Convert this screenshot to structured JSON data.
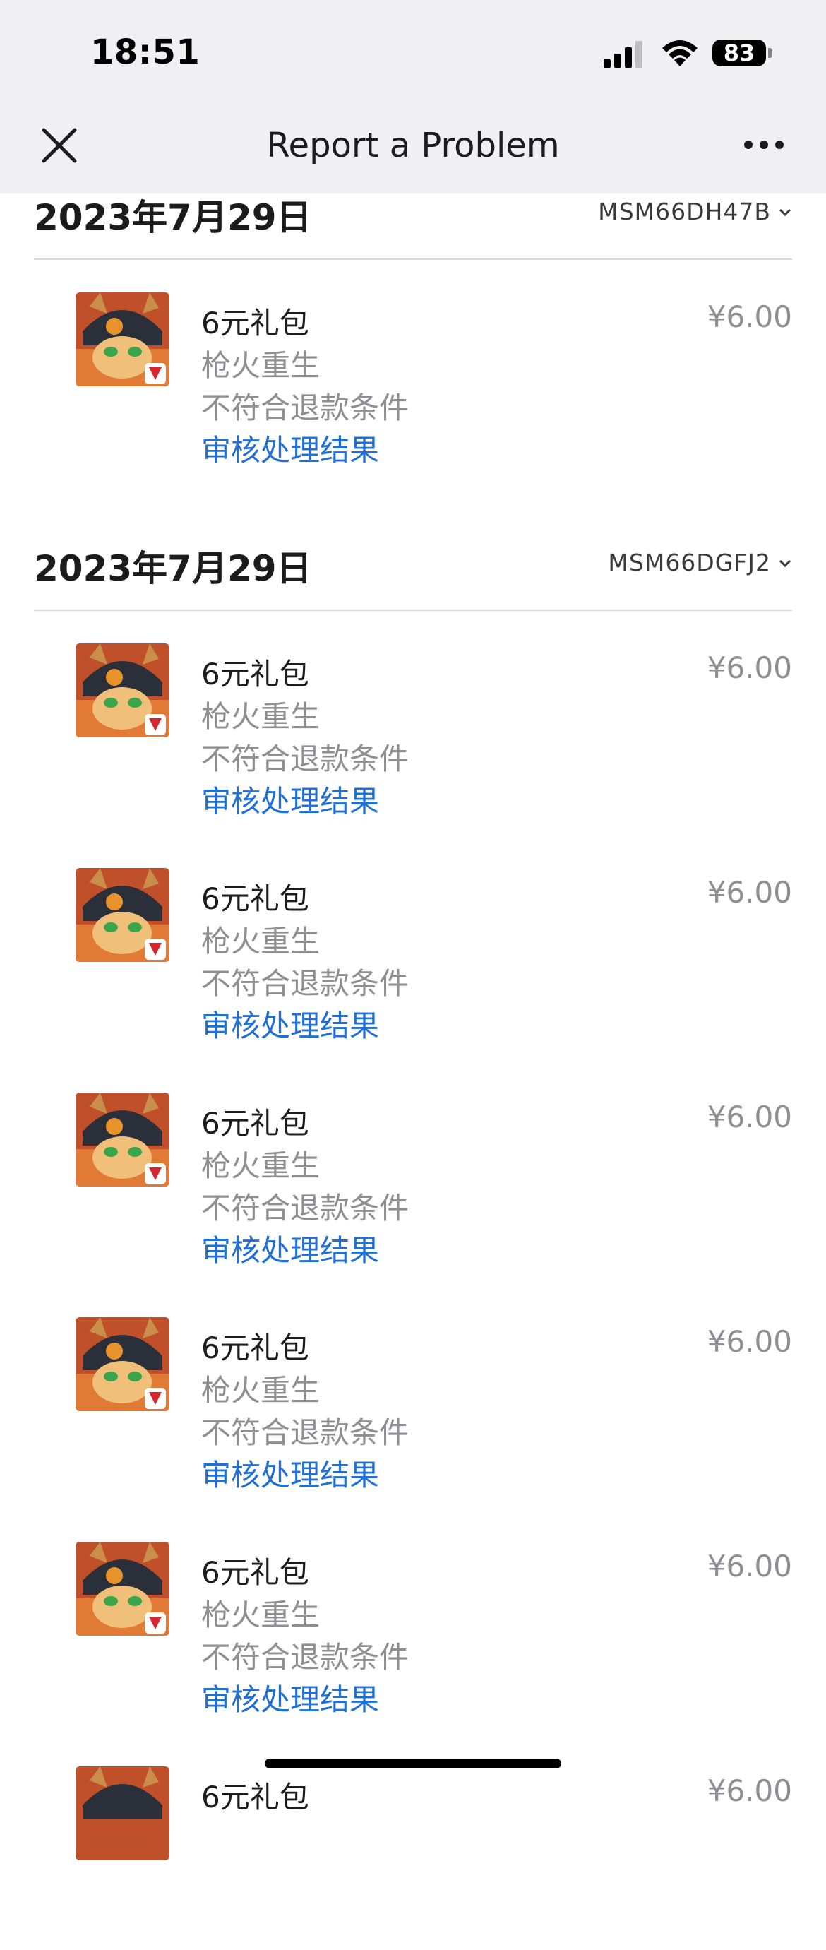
{
  "status_bar": {
    "time": "18:51",
    "battery": "83"
  },
  "nav": {
    "title": "Report a Problem",
    "close_icon": "close-icon",
    "more_icon": "more-icon"
  },
  "sections": [
    {
      "date": "2023年7月29日",
      "order_id": "MSM66DH47B",
      "items": [
        {
          "title": "6元礼包",
          "game": "枪火重生",
          "status": "不符合退款条件",
          "link": "审核处理结果",
          "price": "¥6.00"
        }
      ]
    },
    {
      "date": "2023年7月29日",
      "order_id": "MSM66DGFJ2",
      "items": [
        {
          "title": "6元礼包",
          "game": "枪火重生",
          "status": "不符合退款条件",
          "link": "审核处理结果",
          "price": "¥6.00"
        },
        {
          "title": "6元礼包",
          "game": "枪火重生",
          "status": "不符合退款条件",
          "link": "审核处理结果",
          "price": "¥6.00"
        },
        {
          "title": "6元礼包",
          "game": "枪火重生",
          "status": "不符合退款条件",
          "link": "审核处理结果",
          "price": "¥6.00"
        },
        {
          "title": "6元礼包",
          "game": "枪火重生",
          "status": "不符合退款条件",
          "link": "审核处理结果",
          "price": "¥6.00"
        },
        {
          "title": "6元礼包",
          "game": "枪火重生",
          "status": "不符合退款条件",
          "link": "审核处理结果",
          "price": "¥6.00"
        },
        {
          "title": "6元礼包",
          "game": "",
          "status": "",
          "link": "",
          "price": "¥6.00"
        }
      ]
    }
  ],
  "colors": {
    "link": "#1f6fd6",
    "secondary_text": "#8e8e93",
    "topbar_bg": "#f0f0f2"
  }
}
